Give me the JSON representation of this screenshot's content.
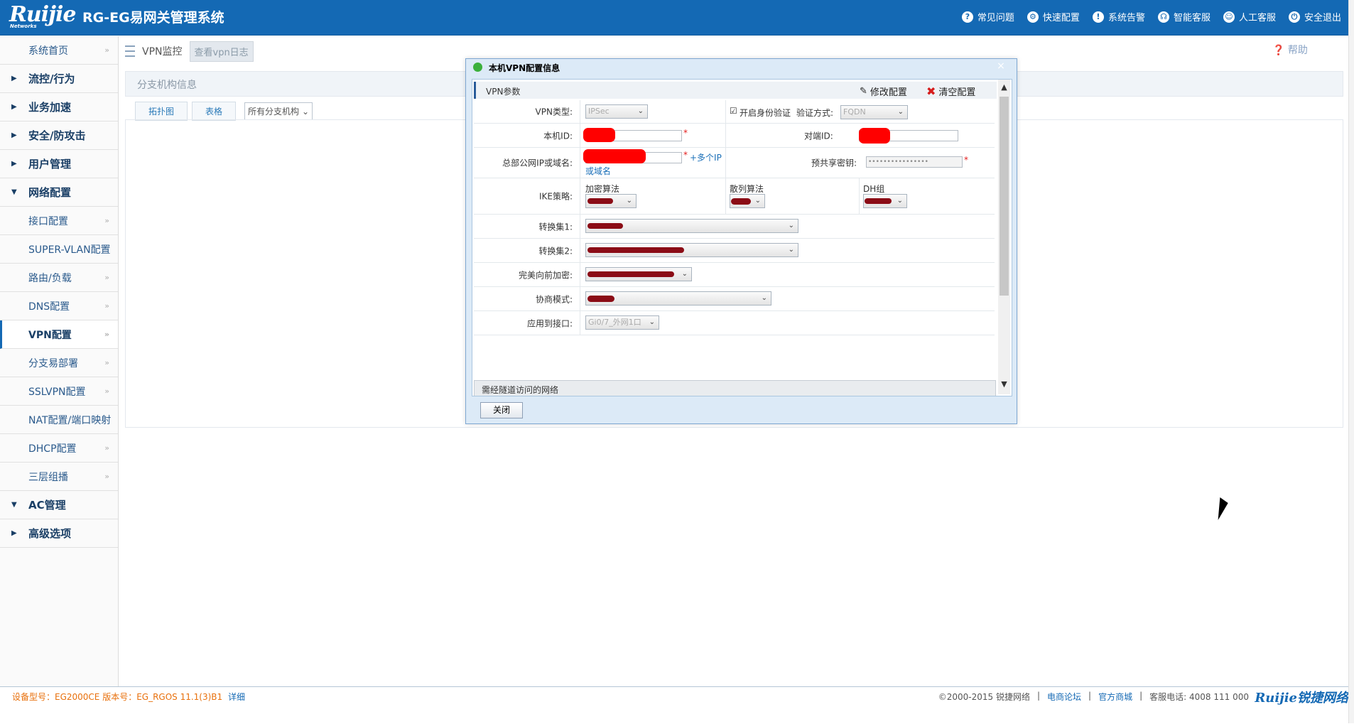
{
  "app": {
    "logo_text": "Ruijie",
    "logo_sub": "Networks",
    "title": "RG-EG易网关管理系统"
  },
  "top_links": [
    {
      "label": "常见问题",
      "icon": "question-icon"
    },
    {
      "label": "快速配置",
      "icon": "gear-icon"
    },
    {
      "label": "系统告警",
      "icon": "warning-icon"
    },
    {
      "label": "智能客服",
      "icon": "headset-icon"
    },
    {
      "label": "人工客服",
      "icon": "person-icon"
    },
    {
      "label": "安全退出",
      "icon": "power-icon"
    }
  ],
  "sidebar": {
    "home": "系统首页",
    "groups": [
      {
        "label": "流控/行为",
        "expanded": false
      },
      {
        "label": "业务加速",
        "expanded": false
      },
      {
        "label": "安全/防攻击",
        "expanded": false
      },
      {
        "label": "用户管理",
        "expanded": false
      },
      {
        "label": "网络配置",
        "expanded": true
      }
    ],
    "sub_items": [
      "接口配置",
      "SUPER-VLAN配置",
      "路由/负载",
      "DNS配置",
      "VPN配置",
      "分支易部署",
      "SSLVPN配置",
      "NAT配置/端口映射",
      "DHCP配置",
      "三层组播"
    ],
    "active_sub": "VPN配置",
    "groups_after": [
      {
        "label": "AC管理",
        "expanded": true
      },
      {
        "label": "高级选项",
        "expanded": false
      }
    ]
  },
  "subheader": {
    "vpn_monitor": "VPN监控",
    "view_log": "查看vpn日志",
    "help": "帮助"
  },
  "branch": {
    "title": "分支机构信息",
    "tabs": [
      "拓扑图",
      "表格"
    ],
    "filter": "所有分支机构"
  },
  "dialog": {
    "title": "本机VPN配置信息",
    "section": "VPN参数",
    "edit_btn": "修改配置",
    "clear_btn": "清空配置",
    "vpn_type_label": "VPN类型:",
    "vpn_type_value": "IPSec",
    "auth_check_label": "开启身份验证",
    "auth_method_label": "验证方式:",
    "auth_method_value": "FQDN",
    "local_id_label": "本机ID:",
    "peer_id_label": "对端ID:",
    "hq_ip_label": "总部公网IP或域名:",
    "multi_ip_a": "+多个IP",
    "multi_ip_b": "或域名",
    "psk_label": "预共享密钥:",
    "psk_value": "••••••••••••••••",
    "ike_label": "IKE策略:",
    "encrypt_label": "加密算法",
    "hash_label": "散列算法",
    "dh_label": "DH组",
    "transform1_label": "转换集1:",
    "transform2_label": "转换集2:",
    "pfs_label": "完美向前加密:",
    "nego_label": "协商模式:",
    "apply_if_label": "应用到接口:",
    "apply_if_value": "Gi0/7_外网1口",
    "network_section": "需经隧道访问的网络",
    "close_btn": "关闭",
    "close_x": "×"
  },
  "footer": {
    "device": "设备型号：EG2000CE 版本号：EG_RGOS 11.1(3)B1",
    "detail": "详细",
    "copyright": "©2000-2015 锐捷网络",
    "forum": "电商论坛",
    "shop": "官方商城",
    "phone": "客服电话:  4008 111 000",
    "logo": "Ruijie锐捷网络"
  }
}
